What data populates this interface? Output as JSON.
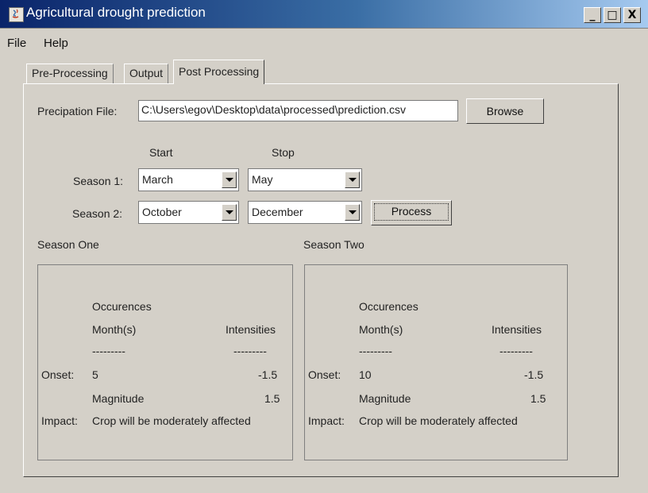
{
  "window": {
    "title": "Agricultural drought prediction",
    "controls": {
      "minimize": "_",
      "maximize": "□",
      "close": "X"
    }
  },
  "menu": [
    "File",
    "Help"
  ],
  "tabs": [
    {
      "label": "Pre-Processing",
      "active": false
    },
    {
      "label": "Output",
      "active": false
    },
    {
      "label": "Post Processing",
      "active": true
    }
  ],
  "form": {
    "precip_label": "Precipation File:",
    "precip_value": "C:\\Users\\egov\\Desktop\\data\\processed\\prediction.csv",
    "browse_label": "Browse",
    "start_label": "Start",
    "stop_label": "Stop",
    "season1_label": "Season 1:",
    "season1_start": "March",
    "season1_stop": "May",
    "season2_label": "Season 2:",
    "season2_start": "October",
    "season2_stop": "December",
    "process_label": "Process"
  },
  "results": {
    "season_one": {
      "heading": "Season One",
      "occurences": "Occurences",
      "months_header": "Month(s)",
      "intensities_header": "Intensities",
      "dashes_left": "---------",
      "dashes_right": "---------",
      "onset_label": "Onset:",
      "onset_month": "5",
      "onset_intensity": "-1.5",
      "magnitude_label": "Magnitude",
      "magnitude_value": "1.5",
      "impact_label": "Impact:",
      "impact_text": "Crop will be  moderately affected"
    },
    "season_two": {
      "heading": "Season Two",
      "occurences": "Occurences",
      "months_header": "Month(s)",
      "intensities_header": "Intensities",
      "dashes_left": "---------",
      "dashes_right": "---------",
      "onset_label": "Onset:",
      "onset_month": "10",
      "onset_intensity": "-1.5",
      "magnitude_label": "Magnitude",
      "magnitude_value": "1.5",
      "impact_label": "Impact:",
      "impact_text": "Crop will be  moderately affected"
    }
  },
  "colors": {
    "titlebar_start": "#0a246a",
    "titlebar_end": "#a6caf0",
    "window_bg": "#d4d0c8"
  }
}
